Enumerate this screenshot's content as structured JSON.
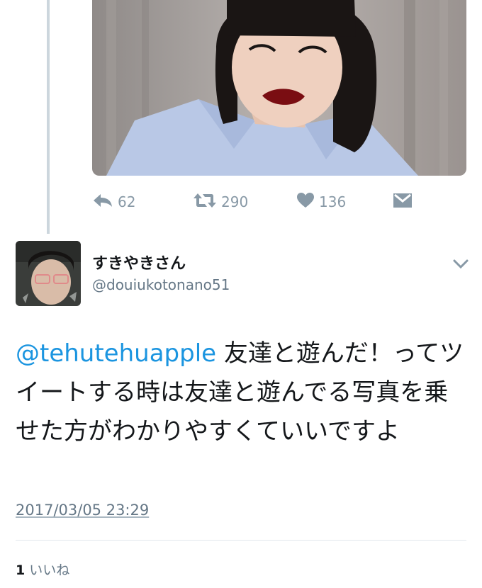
{
  "previous_tweet": {
    "photo_alt": "photo",
    "actions": {
      "reply_count": "62",
      "retweet_count": "290",
      "like_count": "136"
    }
  },
  "tweet": {
    "display_name": "すきやきさん",
    "handle": "@douiukotonano51",
    "mention": "@tehutehuapple",
    "text": " 友達と遊んだ！ってツイートする時は友達と遊んでる写真を乗せた方がわかりやすくていいですよ",
    "timestamp": "2017/03/05 23:29",
    "likes_count": "1",
    "likes_label": "いいね"
  },
  "colors": {
    "link": "#1b95e0",
    "muted": "#8899a6",
    "thread_line": "#ccd6dd"
  },
  "icons": {
    "reply": "reply-icon",
    "retweet": "retweet-icon",
    "like": "heart-icon",
    "dm": "envelope-icon",
    "menu": "chevron-down-icon"
  }
}
